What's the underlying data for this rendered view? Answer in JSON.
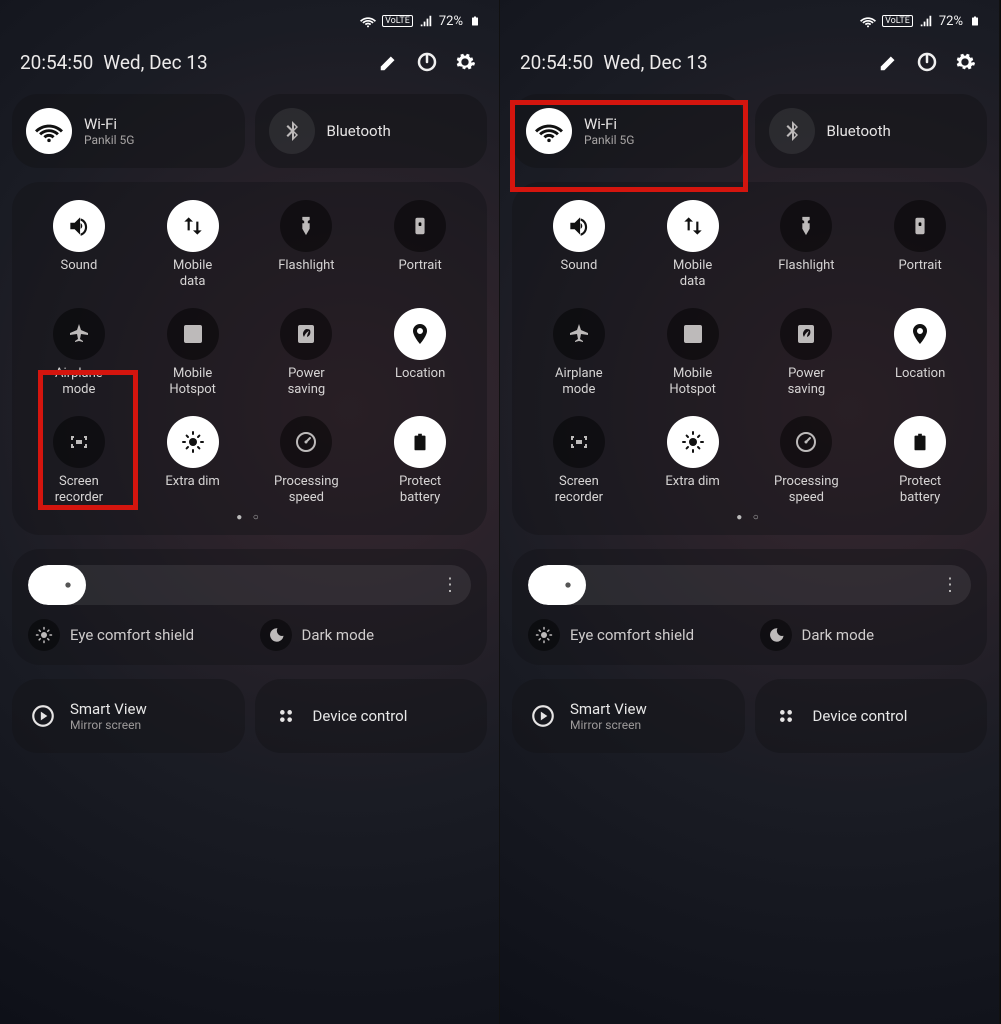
{
  "status": {
    "volte": "VoLTE",
    "battery_text": "72%"
  },
  "header": {
    "time": "20:54:50",
    "date": "Wed, Dec 13"
  },
  "conn": {
    "wifi": {
      "title": "Wi-Fi",
      "sub": "Pankil 5G"
    },
    "bt": {
      "title": "Bluetooth"
    }
  },
  "tiles": {
    "sound": "Sound",
    "mobile_data": "Mobile\ndata",
    "flashlight": "Flashlight",
    "portrait": "Portrait",
    "airplane": "Airplane\nmode",
    "hotspot": "Mobile\nHotspot",
    "power_saving": "Power\nsaving",
    "location": "Location",
    "screen_rec": "Screen\nrecorder",
    "extra_dim": "Extra dim",
    "proc_speed": "Processing\nspeed",
    "protect_batt": "Protect\nbattery"
  },
  "brightness": {
    "eye": "Eye comfort shield",
    "dark": "Dark mode"
  },
  "bottom": {
    "smartview": {
      "title": "Smart View",
      "sub": "Mirror screen"
    },
    "device_ctrl": "Device control"
  }
}
